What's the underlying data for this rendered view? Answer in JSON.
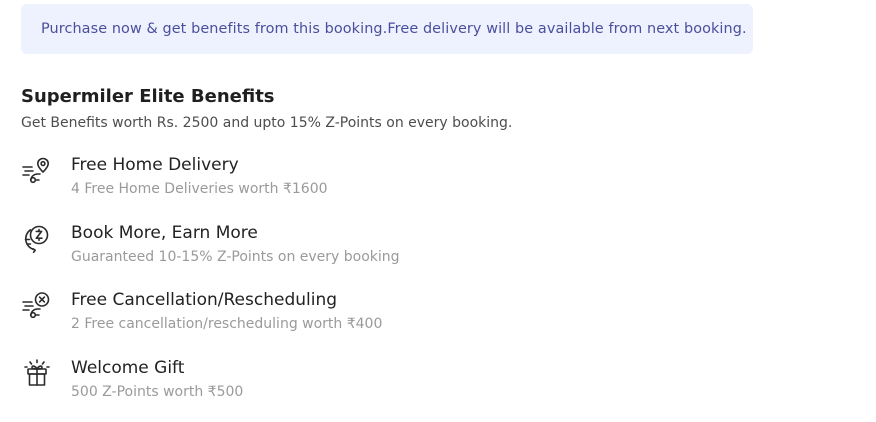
{
  "notice": {
    "text": "Purchase now & get benefits from this booking.Free delivery will be available from next booking."
  },
  "section": {
    "title": "Supermiler Elite Benefits",
    "subtitle": "Get Benefits worth Rs. 2500 and upto 15% Z-Points on every booking."
  },
  "benefits": [
    {
      "icon": "delivery-location-icon",
      "title": "Free Home Delivery",
      "description": "4 Free Home Deliveries worth ₹1600"
    },
    {
      "icon": "earn-points-icon",
      "title": "Book More, Earn More",
      "description": "Guaranteed 10-15% Z-Points on every booking"
    },
    {
      "icon": "cancellation-icon",
      "title": "Free Cancellation/Rescheduling",
      "description": "2 Free cancellation/rescheduling worth ₹400"
    },
    {
      "icon": "gift-icon",
      "title": "Welcome Gift",
      "description": "500 Z-Points worth ₹500"
    }
  ],
  "colors": {
    "notice_bg": "#eef2ff",
    "notice_text": "#4a4f9c",
    "title": "#1f1f1f",
    "muted": "#9a9a9a"
  }
}
